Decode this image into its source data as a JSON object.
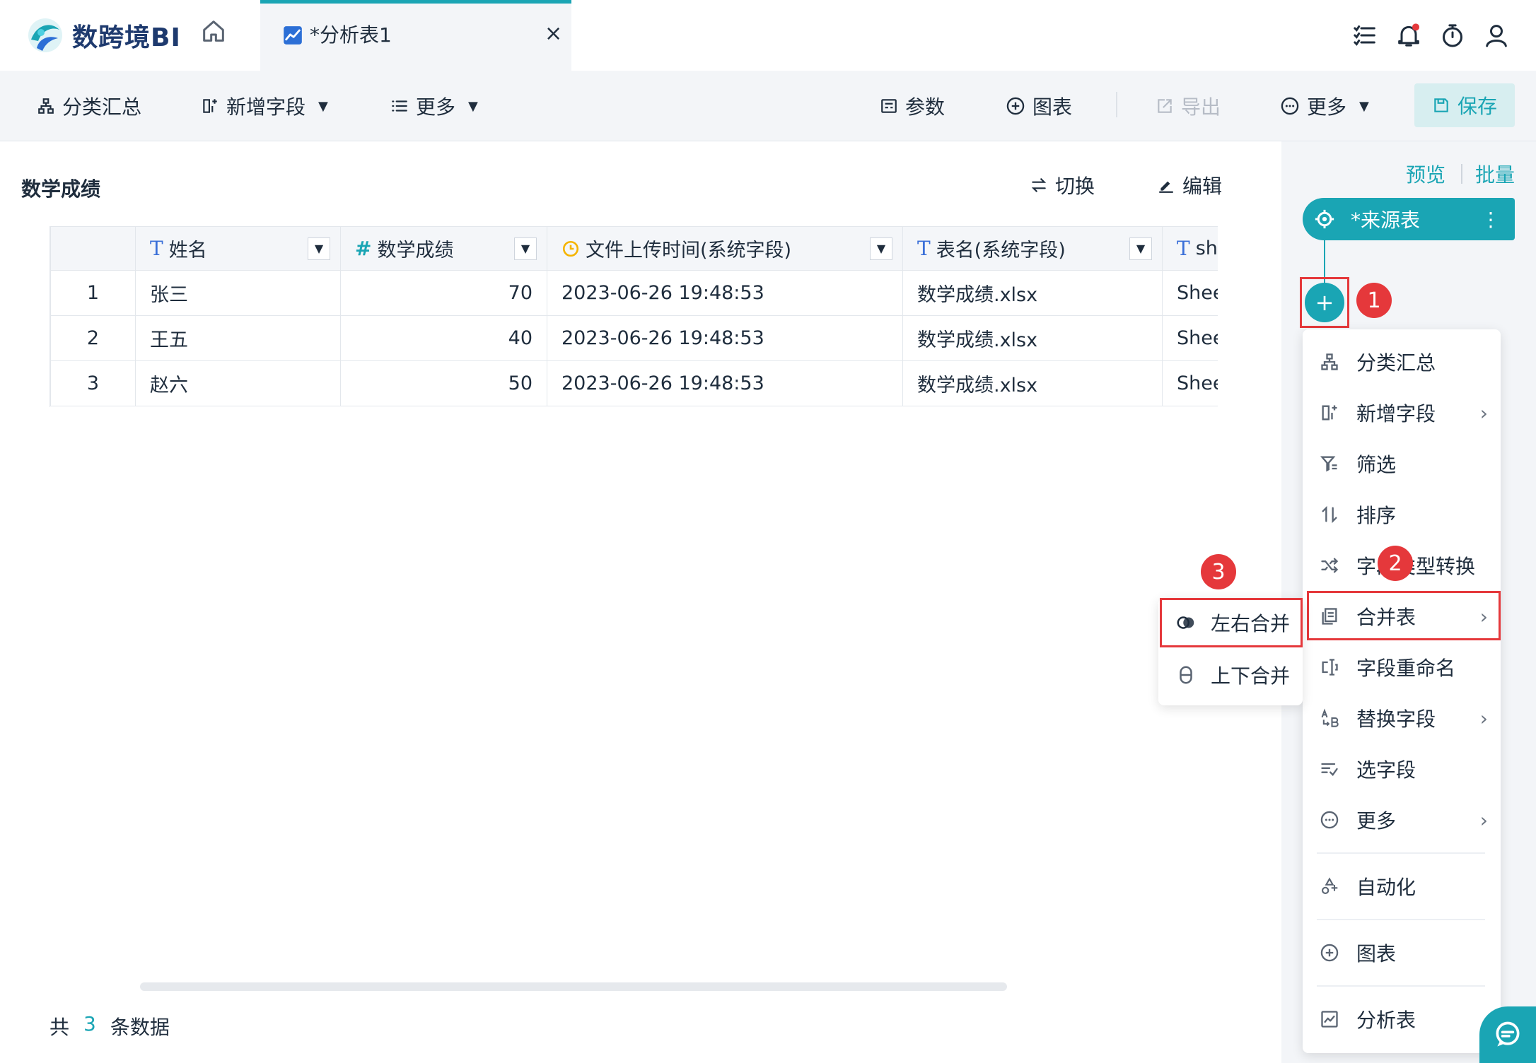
{
  "app": {
    "logo_text": "数跨境BI"
  },
  "tab": {
    "label": "*分析表1",
    "close": "×"
  },
  "toolbar": {
    "group_summary": "分类汇总",
    "add_field": "新增字段",
    "more_left": "更多",
    "params": "参数",
    "chart": "图表",
    "export": "导出",
    "more_right": "更多",
    "save": "保存"
  },
  "panel": {
    "title": "数学成绩",
    "switch": "切换",
    "edit": "编辑"
  },
  "table": {
    "columns": [
      {
        "type": "T",
        "label": "姓名"
      },
      {
        "type": "#",
        "label": "数学成绩"
      },
      {
        "type": "time",
        "label": "文件上传时间(系统字段)"
      },
      {
        "type": "T",
        "label": "表名(系统字段)"
      },
      {
        "type": "T",
        "label": "sh"
      }
    ],
    "rows": [
      {
        "idx": "1",
        "name": "张三",
        "score": "70",
        "time": "2023-06-26 19:48:53",
        "file": "数学成绩.xlsx",
        "sheet": "Shee"
      },
      {
        "idx": "2",
        "name": "王五",
        "score": "40",
        "time": "2023-06-26 19:48:53",
        "file": "数学成绩.xlsx",
        "sheet": "Shee"
      },
      {
        "idx": "3",
        "name": "赵六",
        "score": "50",
        "time": "2023-06-26 19:48:53",
        "file": "数学成绩.xlsx",
        "sheet": "Shee"
      }
    ]
  },
  "footer": {
    "prefix": "共",
    "count": "3",
    "suffix": "条数据"
  },
  "right": {
    "preview": "预览",
    "batch": "批量",
    "source_node": "*来源表",
    "add": "+"
  },
  "badges": {
    "one": "1",
    "two": "2",
    "three": "3"
  },
  "menu": {
    "items": [
      {
        "label": "分类汇总"
      },
      {
        "label": "新增字段"
      },
      {
        "label": "筛选"
      },
      {
        "label": "排序"
      },
      {
        "label": "字段类型转换"
      },
      {
        "label": "合并表"
      },
      {
        "label": "字段重命名"
      },
      {
        "label": "替换字段"
      },
      {
        "label": "选字段"
      },
      {
        "label": "更多"
      },
      {
        "label": "自动化"
      },
      {
        "label": "图表"
      },
      {
        "label": "分析表"
      }
    ]
  },
  "submenu": {
    "items": [
      {
        "label": "左右合并"
      },
      {
        "label": "上下合并"
      }
    ]
  },
  "colors": {
    "accent": "#1aa5b4",
    "highlight": "#e5383b",
    "type_text": "#3a6fd8"
  },
  "icons": {
    "home": "home-icon",
    "tab": "chart-line-icon",
    "list": "list-icon",
    "bell": "bell-icon",
    "timer": "timer-icon",
    "user": "user-icon",
    "chat": "chat-icon"
  }
}
